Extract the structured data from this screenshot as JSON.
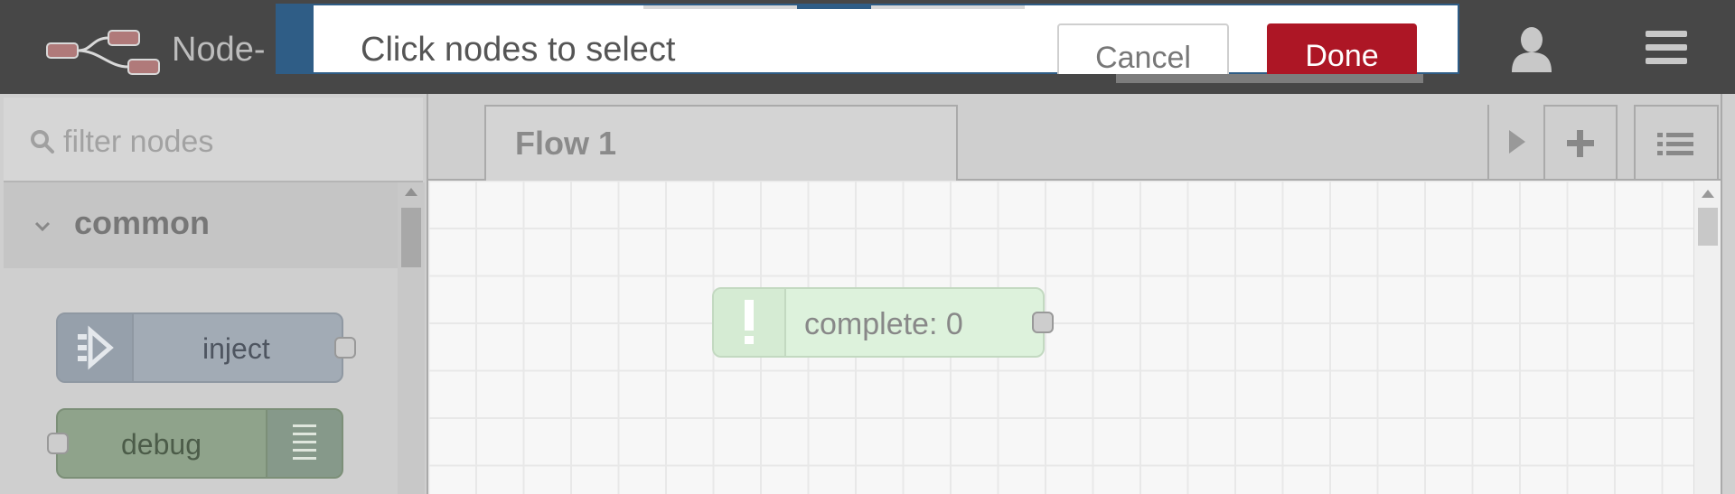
{
  "header": {
    "app_title": "Node-"
  },
  "notification": {
    "message": "Click nodes to select",
    "cancel_label": "Cancel",
    "done_label": "Done"
  },
  "palette": {
    "filter_placeholder": "filter nodes",
    "category": "common",
    "nodes": [
      {
        "label": "inject"
      },
      {
        "label": "debug"
      }
    ]
  },
  "workspace": {
    "tabs": [
      {
        "label": "Flow 1"
      }
    ],
    "nodes": [
      {
        "label": "complete: 0"
      }
    ]
  },
  "colors": {
    "header_bg": "#474747",
    "done_button": "#ad1625",
    "notification_accent": "#2f5d86",
    "inject_node": "#a2abb5",
    "debug_node": "#8fa38b",
    "complete_node": "#ddf2dc"
  },
  "icons": [
    "node-red-logo-icon",
    "user-icon",
    "hamburger-menu-icon",
    "search-icon",
    "chevron-down-icon",
    "inject-arrow-icon",
    "debug-list-icon",
    "alert-exclamation-icon",
    "play-arrow-icon",
    "plus-icon",
    "list-icon"
  ]
}
